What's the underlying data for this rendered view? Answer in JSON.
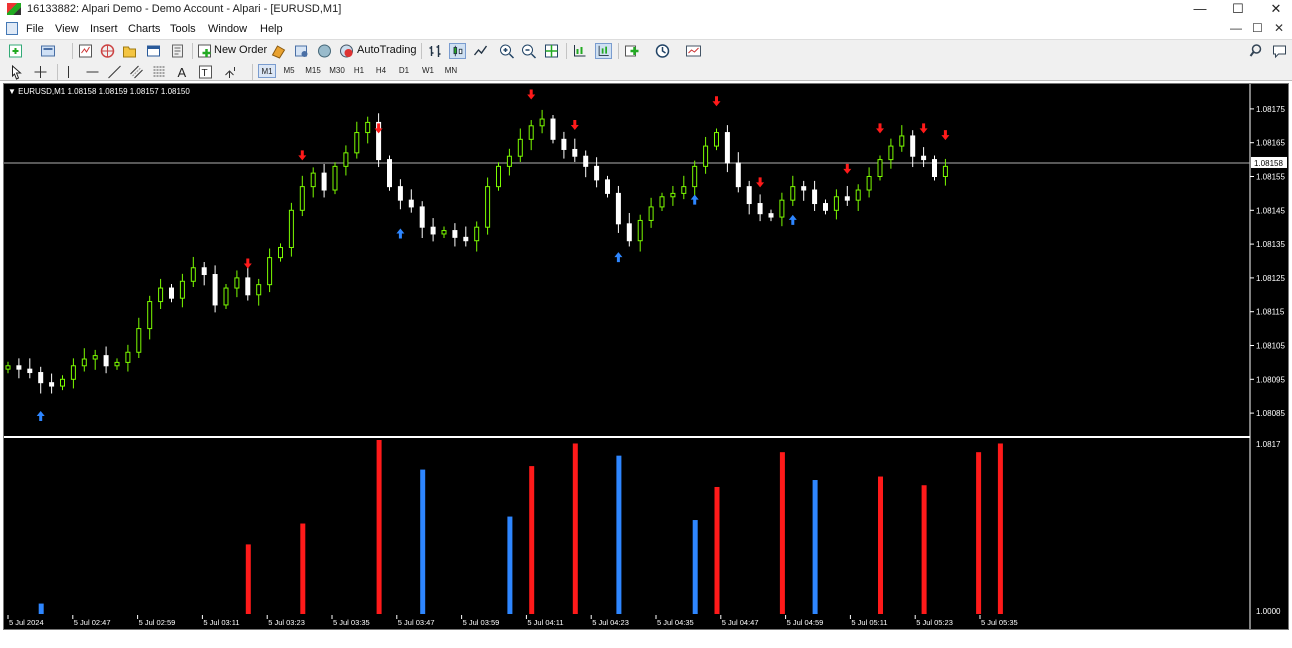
{
  "window": {
    "title": "16133882: Alpari Demo - Demo Account - Alpari - [EURUSD,M1]",
    "controls": [
      "—",
      "☐",
      "✕"
    ]
  },
  "menu": [
    "File",
    "View",
    "Insert",
    "Charts",
    "Tools",
    "Window",
    "Help"
  ],
  "menu_right": [
    "—",
    "☐",
    "✕"
  ],
  "toolbar": {
    "new_order": "New Order",
    "autotrading": "AutoTrading",
    "timeframes": [
      "M1",
      "M5",
      "M15",
      "M30",
      "H1",
      "H4",
      "D1",
      "W1",
      "MN"
    ],
    "active_timeframe": "M1"
  },
  "chart_data": [
    {
      "type": "candlestick",
      "header": "EURUSD,M1  1.08158 1.08159 1.08157 1.08150",
      "symbol": "EURUSD",
      "timeframe": "M1",
      "current_price_label": "1.08158",
      "current_price": 1.08159,
      "y_ticks": [
        "1.08175",
        "1.08165",
        "1.08155",
        "1.08145",
        "1.08135",
        "1.08125",
        "1.08115",
        "1.08105",
        "1.08095",
        "1.08085"
      ],
      "y_tick_values": [
        1.08175,
        1.08165,
        1.08155,
        1.08145,
        1.08135,
        1.08125,
        1.08115,
        1.08105,
        1.08095,
        1.08085
      ],
      "ylim": [
        1.0808,
        1.0818
      ],
      "up_color": "#7CFC00",
      "down_color": "#ffffff",
      "bg_color": "#000000",
      "closes": [
        1.08099,
        1.08098,
        1.08097,
        1.08094,
        1.08093,
        1.08095,
        1.08099,
        1.08101,
        1.08102,
        1.08099,
        1.081,
        1.08103,
        1.0811,
        1.08118,
        1.08122,
        1.08119,
        1.08124,
        1.08128,
        1.08126,
        1.08117,
        1.08122,
        1.08125,
        1.0812,
        1.08123,
        1.08131,
        1.08134,
        1.08145,
        1.08152,
        1.08156,
        1.08151,
        1.08158,
        1.08162,
        1.08168,
        1.08171,
        1.0816,
        1.08152,
        1.08148,
        1.08146,
        1.0814,
        1.08138,
        1.08139,
        1.08137,
        1.08136,
        1.0814,
        1.08152,
        1.08158,
        1.08161,
        1.08166,
        1.0817,
        1.08172,
        1.08166,
        1.08163,
        1.08161,
        1.08158,
        1.08154,
        1.0815,
        1.08141,
        1.08136,
        1.08142,
        1.08146,
        1.08149,
        1.0815,
        1.08152,
        1.08158,
        1.08164,
        1.08168,
        1.08159,
        1.08152,
        1.08147,
        1.08144,
        1.08143,
        1.08148,
        1.08152,
        1.08151,
        1.08147,
        1.08145,
        1.08149,
        1.08148,
        1.08151,
        1.08155,
        1.0816,
        1.08164,
        1.08167,
        1.08161,
        1.0816,
        1.08155,
        1.08158
      ],
      "highs_pad": 3e-05,
      "buy_arrows_at": [
        3,
        36,
        56,
        63,
        72
      ],
      "sell_arrows_at": [
        22,
        27,
        34,
        48,
        52,
        65,
        69,
        77,
        80,
        84,
        86
      ],
      "x_ticks": [
        "5 Jul 2024",
        "5 Jul 02:47",
        "5 Jul 02:59",
        "5 Jul 03:11",
        "5 Jul 03:23",
        "5 Jul 03:35",
        "5 Jul 03:47",
        "5 Jul 03:59",
        "5 Jul 04:11",
        "5 Jul 04:23",
        "5 Jul 04:35",
        "5 Jul 04:47",
        "5 Jul 04:59",
        "5 Jul 05:11",
        "5 Jul 05:23",
        "5 Jul 05:35"
      ]
    },
    {
      "type": "bar",
      "description": "signal histogram",
      "y_ticks": [
        "1.0817",
        "1.0000"
      ],
      "ylim": [
        0,
        1
      ],
      "bars": [
        {
          "i": 3,
          "color": "#2e86ff",
          "value": 0.06
        },
        {
          "i": 22,
          "color": "#ff1a1a",
          "value": 0.4
        },
        {
          "i": 27,
          "color": "#ff1a1a",
          "value": 0.52
        },
        {
          "i": 34,
          "color": "#ff1a1a",
          "value": 1.0
        },
        {
          "i": 38,
          "color": "#2e86ff",
          "value": 0.83
        },
        {
          "i": 46,
          "color": "#2e86ff",
          "value": 0.56
        },
        {
          "i": 48,
          "color": "#ff1a1a",
          "value": 0.85
        },
        {
          "i": 52,
          "color": "#ff1a1a",
          "value": 0.98
        },
        {
          "i": 56,
          "color": "#2e86ff",
          "value": 0.91
        },
        {
          "i": 63,
          "color": "#2e86ff",
          "value": 0.54
        },
        {
          "i": 65,
          "color": "#ff1a1a",
          "value": 0.73
        },
        {
          "i": 71,
          "color": "#ff1a1a",
          "value": 0.93
        },
        {
          "i": 74,
          "color": "#2e86ff",
          "value": 0.77
        },
        {
          "i": 80,
          "color": "#ff1a1a",
          "value": 0.79
        },
        {
          "i": 84,
          "color": "#ff1a1a",
          "value": 0.74
        },
        {
          "i": 89,
          "color": "#ff1a1a",
          "value": 0.93
        },
        {
          "i": 91,
          "color": "#ff1a1a",
          "value": 0.98
        }
      ]
    }
  ]
}
